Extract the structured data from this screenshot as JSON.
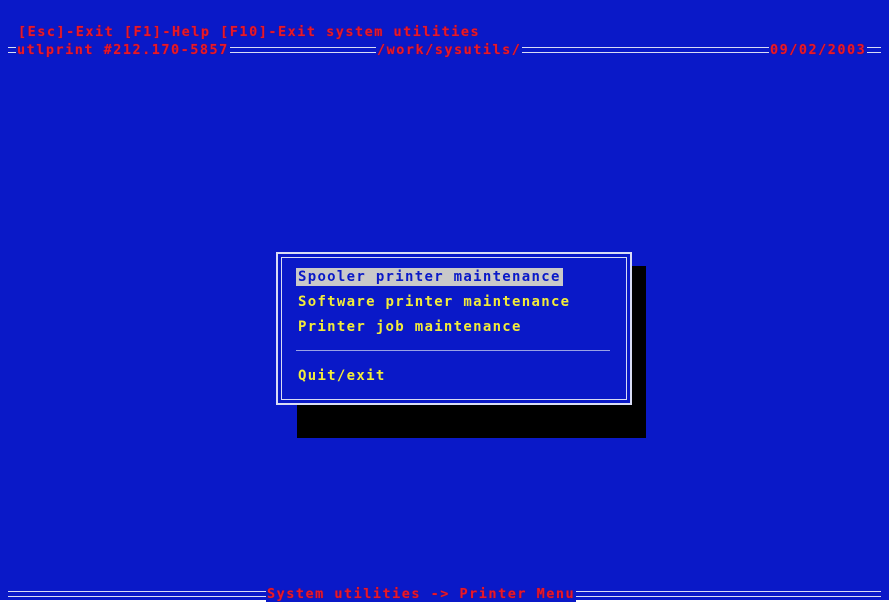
{
  "header": {
    "key_hints": "[Esc]-Exit [F1]-Help [F10]-Exit system utilities",
    "printer_id": "utlprint #212.170-5857",
    "path": "/work/sysutils/",
    "date": "09/02/2003"
  },
  "menu": {
    "items": [
      {
        "label": "Spooler printer maintenance",
        "selected": true
      },
      {
        "label": "Software printer maintenance",
        "selected": false
      },
      {
        "label": "Printer job maintenance",
        "selected": false
      }
    ],
    "exit_label": "Quit/exit"
  },
  "footer": {
    "breadcrumb": "System utilities -> Printer Menu"
  },
  "colors": {
    "background": "#0a19c8",
    "hint_text": "#e8182a",
    "menu_text": "#f2ec3a",
    "highlight": "#c9c9c9",
    "shadow": "#000000"
  }
}
